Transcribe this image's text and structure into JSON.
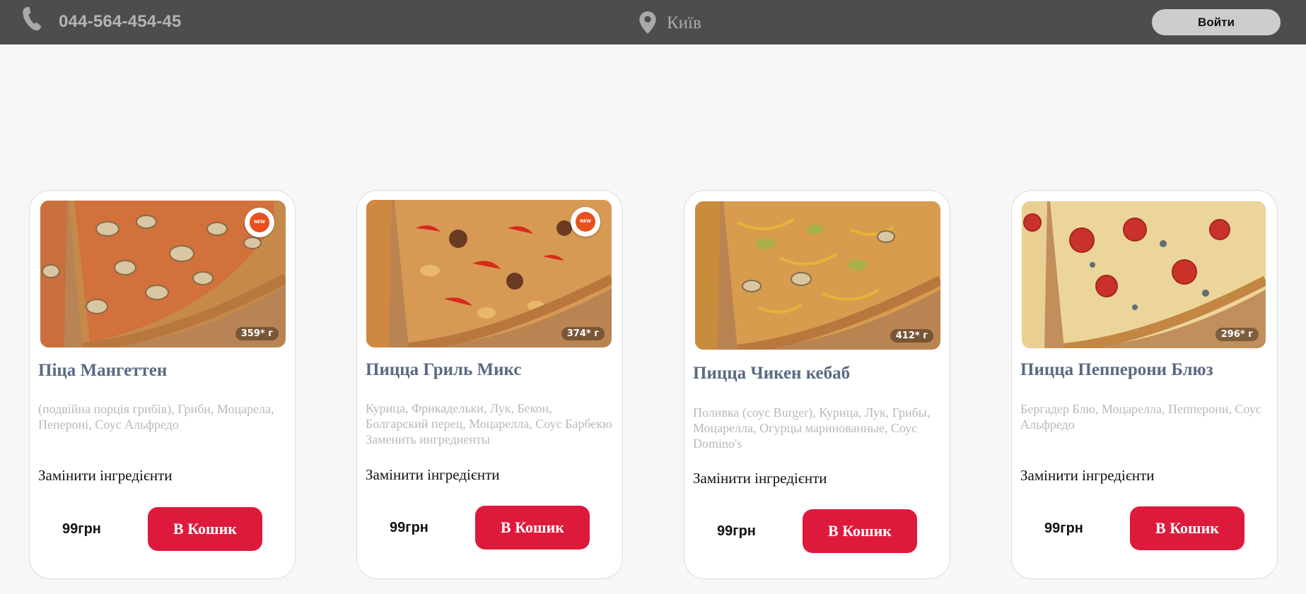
{
  "header": {
    "phone": "044-564-454-45",
    "city": "Київ",
    "login_label": "Войти"
  },
  "products": [
    {
      "weight": "359* г",
      "is_new": true,
      "new_badge": "NEW",
      "title": "Піца Мангеттен",
      "description": "(подвійна порція грибів), Гриби, Моцарела, Пепероні, Соус Альфредо",
      "change_label": "Замінити інгредієнти",
      "price": "99грн",
      "cart_label": "В Кошик"
    },
    {
      "weight": "374* г",
      "is_new": true,
      "new_badge": "NEW",
      "title": "Пицца Гриль Микс",
      "description": "Курица, Фрикадельки, Лук, Бекон, Болгарский перец, Моцарелла, Соус Барбекю Заменить ингредиенты",
      "change_label": "Замінити інгредієнти",
      "price": "99грн",
      "cart_label": "В Кошик"
    },
    {
      "weight": "412* г",
      "is_new": false,
      "title": "Пицца Чикен кебаб",
      "description": "Поливка (соус Burger), Курица, Лук, Грибы, Моцарелла, Огурцы маринованные, Соус Domino's",
      "change_label": "Замінити інгредієнти",
      "price": "99грн",
      "cart_label": "В Кошик"
    },
    {
      "weight": "296* г",
      "is_new": false,
      "title": "Пицца Пепперони Блюз",
      "description": "Бергадер Блю, Моцарелла, Пепперони, Соус Альфредо",
      "change_label": "Замінити інгредієнти",
      "price": "99грн",
      "cart_label": "В Кошик"
    }
  ]
}
